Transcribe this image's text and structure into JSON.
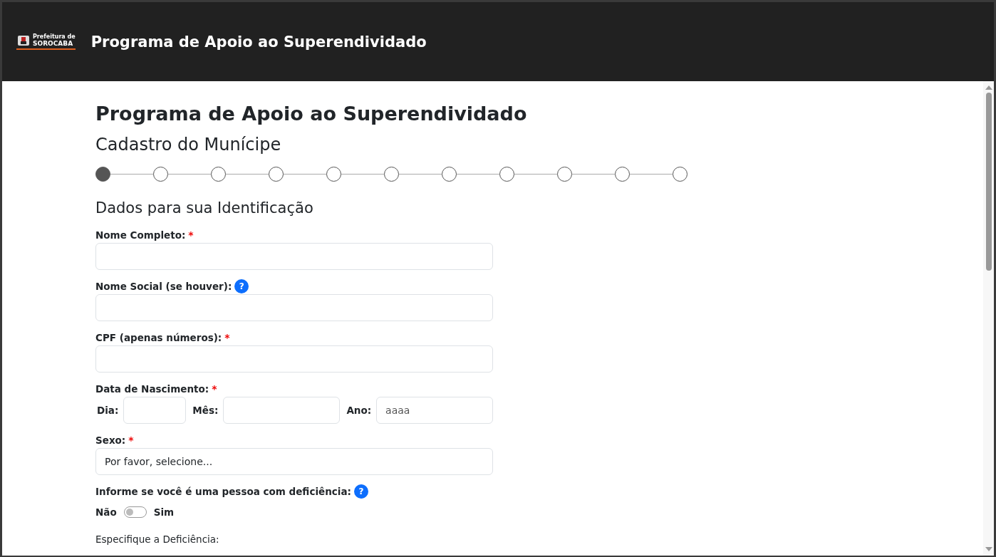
{
  "header": {
    "logo_lines": [
      "Prefeitura de",
      "SOROCABA"
    ],
    "title": "Programa de Apoio ao Superendividado"
  },
  "page": {
    "title": "Programa de Apoio ao Superendividado",
    "subtitle": "Cadastro do Munícipe"
  },
  "steps": [
    {
      "selected": true
    },
    {
      "selected": false
    },
    {
      "selected": false
    },
    {
      "selected": false
    },
    {
      "selected": false
    },
    {
      "selected": false
    },
    {
      "selected": false
    },
    {
      "selected": false
    },
    {
      "selected": false
    },
    {
      "selected": false
    },
    {
      "selected": false
    }
  ],
  "section_title": "Dados para sua Identificação",
  "fields": [
    {
      "kind": "text",
      "label": "Nome Completo:",
      "required": true,
      "help": false
    },
    {
      "kind": "text",
      "label": "Nome Social (se houver):",
      "required": false,
      "help": true
    },
    {
      "kind": "text",
      "label": "CPF (apenas números):",
      "required": true,
      "help": false
    },
    {
      "kind": "date",
      "label": "Data de Nascimento:",
      "required": true,
      "help": false,
      "parts": [
        {
          "label": "Dia:"
        },
        {
          "label": "Mês:"
        },
        {
          "label": "Ano:",
          "placeholder": "aaaa"
        }
      ]
    },
    {
      "kind": "select",
      "label": "Sexo:",
      "required": true,
      "help": false,
      "value": "Por favor, selecione..."
    },
    {
      "kind": "switch",
      "label": "Informe se você é uma pessoa com deficiência:",
      "required": false,
      "help": true,
      "off_label": "Não",
      "on_label": "Sim",
      "on": false
    },
    {
      "kind": "cutoff",
      "label": "Especifique a Deficiência:"
    }
  ],
  "required_mark": "*",
  "help_mark": "?"
}
